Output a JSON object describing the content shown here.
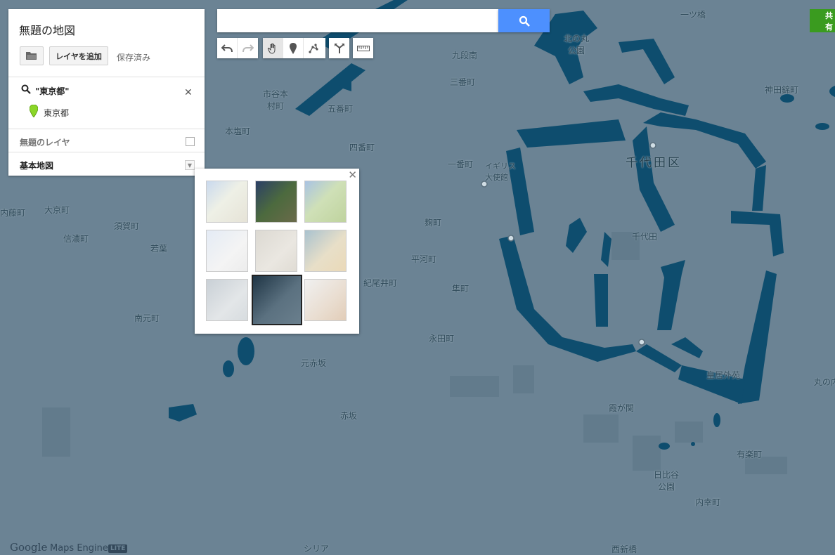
{
  "panel": {
    "title": "無題の地図",
    "add_layer_label": "レイヤを追加",
    "save_status": "保存済み",
    "search_layer": {
      "title": "\"東京都\"",
      "result": "東京都"
    },
    "untitled_layer": "無題のレイヤ",
    "base_map": "基本地図"
  },
  "search": {
    "value": "",
    "placeholder": ""
  },
  "share": {
    "label": "共有"
  },
  "branding": {
    "logo": "Google",
    "product": "Maps Engine",
    "badge": "LITE"
  },
  "map_labels": [
    "一ツ橋",
    "北の丸公園",
    "九段南",
    "三番町",
    "神田錦町",
    "市谷本村町",
    "五番町",
    "本塩町",
    "四番町",
    "一番町",
    "イギリス大使館",
    "千代田区",
    "千代田",
    "内藤町",
    "大京町",
    "須賀町",
    "信濃町",
    "若葉",
    "麹町",
    "平河町",
    "紀尾井町",
    "隼町",
    "南元町",
    "永田町",
    "元赤坂",
    "皇居外苑",
    "赤坂",
    "霞が関",
    "有楽町",
    "日比谷公園",
    "内幸町",
    "西新橋",
    "丸の内",
    "シリア"
  ],
  "colors": {
    "map_bg": "#6b8394",
    "water": "#0e4d6e",
    "search_button": "#4d90fe",
    "share_button": "#3a9b1f"
  },
  "icons": [
    "folder-icon",
    "search-icon",
    "close-icon",
    "map-pin-icon",
    "undo-icon",
    "redo-icon",
    "pan-hand-icon",
    "marker-icon",
    "draw-line-icon",
    "route-icon",
    "measure-ruler-icon"
  ]
}
